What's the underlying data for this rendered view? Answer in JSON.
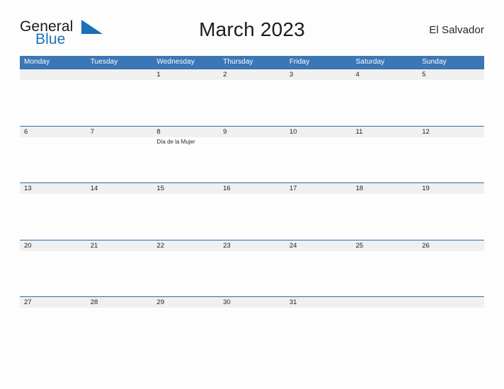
{
  "brand": {
    "name_part1": "General",
    "name_part2": "Blue",
    "flag_icon": "blue-triangle-flag-icon",
    "colors": {
      "dark_text": "#1a1a1a",
      "blue_text": "#1d6fb8",
      "flag": "#1d6fb8"
    }
  },
  "header": {
    "title": "March 2023",
    "region": "El Salvador"
  },
  "colors": {
    "header_blue": "#3b77b7",
    "band_gray": "#f0f0f0",
    "rule_blue": "#2e6ca4",
    "page_background": "#fdfdfd",
    "text": "#1d1d1d"
  },
  "calendar": {
    "month": "March",
    "year": "2023",
    "weekday_headers": [
      "Monday",
      "Tuesday",
      "Wednesday",
      "Thursday",
      "Friday",
      "Saturday",
      "Sunday"
    ],
    "weeks": [
      [
        {
          "num": "",
          "events": []
        },
        {
          "num": "",
          "events": []
        },
        {
          "num": "1",
          "events": []
        },
        {
          "num": "2",
          "events": []
        },
        {
          "num": "3",
          "events": []
        },
        {
          "num": "4",
          "events": []
        },
        {
          "num": "5",
          "events": []
        }
      ],
      [
        {
          "num": "6",
          "events": []
        },
        {
          "num": "7",
          "events": []
        },
        {
          "num": "8",
          "events": [
            "Día de la Mujer"
          ]
        },
        {
          "num": "9",
          "events": []
        },
        {
          "num": "10",
          "events": []
        },
        {
          "num": "11",
          "events": []
        },
        {
          "num": "12",
          "events": []
        }
      ],
      [
        {
          "num": "13",
          "events": []
        },
        {
          "num": "14",
          "events": []
        },
        {
          "num": "15",
          "events": []
        },
        {
          "num": "16",
          "events": []
        },
        {
          "num": "17",
          "events": []
        },
        {
          "num": "18",
          "events": []
        },
        {
          "num": "19",
          "events": []
        }
      ],
      [
        {
          "num": "20",
          "events": []
        },
        {
          "num": "21",
          "events": []
        },
        {
          "num": "22",
          "events": []
        },
        {
          "num": "23",
          "events": []
        },
        {
          "num": "24",
          "events": []
        },
        {
          "num": "25",
          "events": []
        },
        {
          "num": "26",
          "events": []
        }
      ],
      [
        {
          "num": "27",
          "events": []
        },
        {
          "num": "28",
          "events": []
        },
        {
          "num": "29",
          "events": []
        },
        {
          "num": "30",
          "events": []
        },
        {
          "num": "31",
          "events": []
        },
        {
          "num": "",
          "events": []
        },
        {
          "num": "",
          "events": []
        }
      ]
    ]
  }
}
